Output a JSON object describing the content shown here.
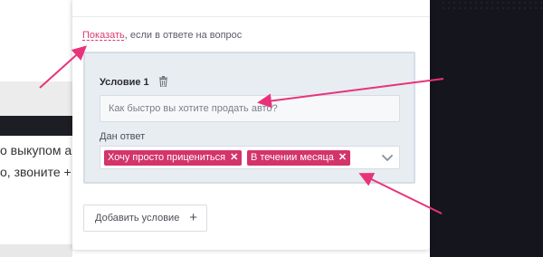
{
  "background": {
    "line1": "о выкупом авто",
    "line2": "о, звоните +"
  },
  "show_line": {
    "link": "Показать",
    "text": ", если в ответе на вопрос"
  },
  "condition": {
    "title": "Условие 1",
    "question_placeholder": "Как быстро вы хотите продать авто?",
    "answer_label": "Дан ответ",
    "tags": [
      "Хочу просто прицениться",
      "В течении месяца"
    ],
    "tag_remove": "✕"
  },
  "add_condition": {
    "label": "Добавить условие",
    "plus": "+"
  },
  "icons": {
    "trash": "trash-icon",
    "chevron": "chevron-down-icon",
    "arrow": "arrow-annotation"
  },
  "colors": {
    "accent": "#d3346a",
    "annotation": "#e8337a",
    "panel": "#e8edf2",
    "dark": "#15151e"
  }
}
